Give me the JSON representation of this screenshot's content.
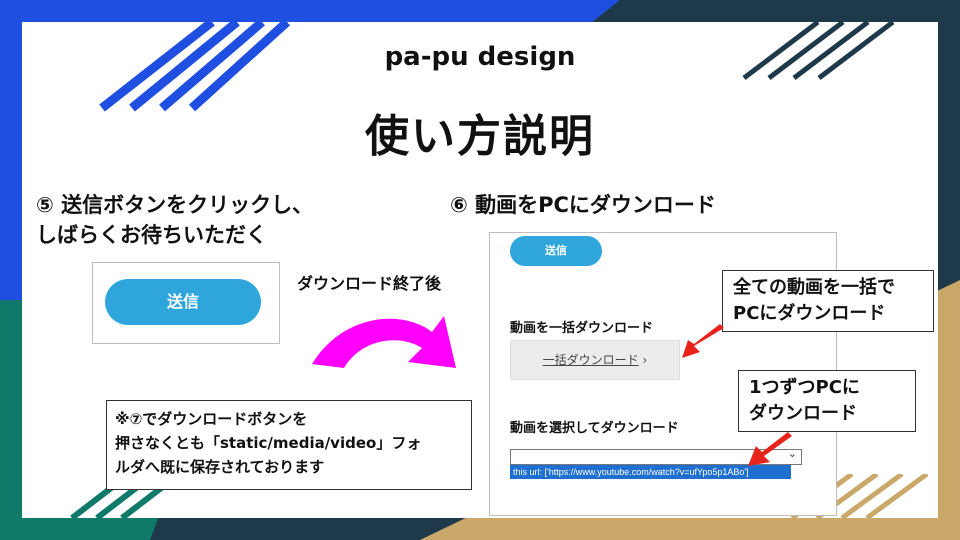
{
  "brand": "pa-pu design",
  "title": "使い方説明",
  "step5": {
    "line1": "⑤ 送信ボタンをクリックし、",
    "line2": "しばらくお待ちいただく",
    "button_label": "送信"
  },
  "arrow_label": "ダウンロード終了後",
  "step6": {
    "heading": "⑥ 動画をPCにダウンロード",
    "send_button": "送信",
    "bulk_heading": "動画を一括ダウンロード",
    "bulk_button": "一括ダウンロード",
    "bulk_chevron": "›",
    "select_heading": "動画を選択してダウンロード",
    "select_chevron": "⌄",
    "option_text": "this url: ['https://www.youtube.com/watch?v=ufYpo5p1ABo']"
  },
  "callout_bulk": {
    "line1": "全ての動画を一括で",
    "line2": "PCにダウンロード"
  },
  "callout_single": {
    "line1": "1つずつPCに",
    "line2": "ダウンロード"
  },
  "note": {
    "line1": "※⑦でダウンロードボタンを",
    "line2": "押さなくとも「static/media/video」フォ",
    "line3": "ルダへ既に保存されております"
  },
  "colors": {
    "blue_stripes": "#1f4fe0",
    "navy": "#1e3a4a",
    "teal": "#0f7a6a",
    "gold": "#c9a86a",
    "button_blue": "#2ea6dc",
    "arrow_magenta": "#ff00ff",
    "arrow_red": "#e8231c"
  }
}
